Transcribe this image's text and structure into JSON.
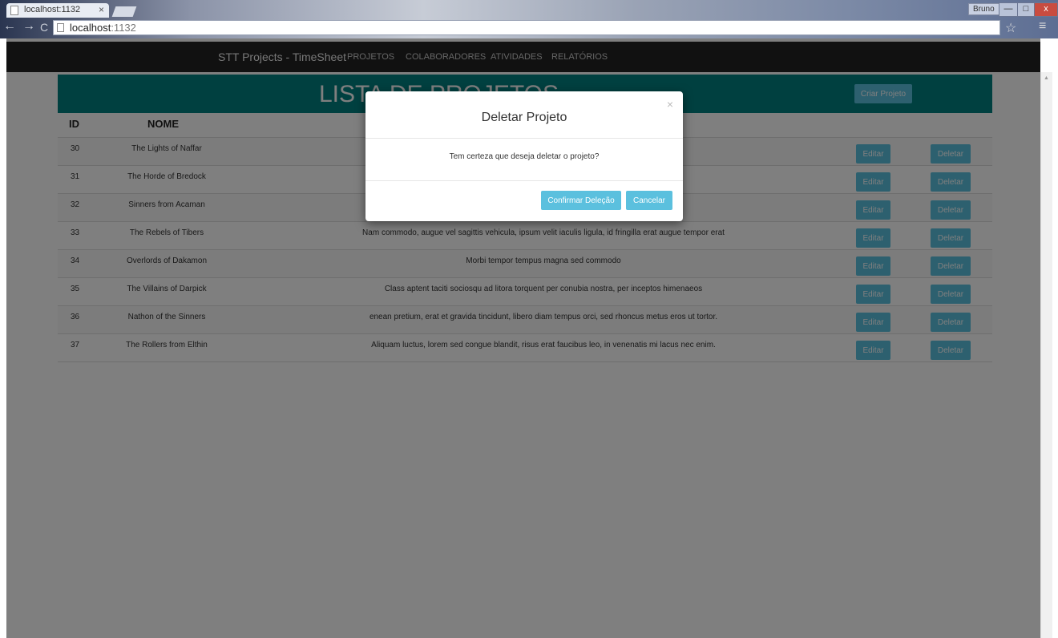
{
  "browser": {
    "tab_title": "localhost:1132",
    "tab_close": "×",
    "address_host": "localhost",
    "address_port": ":1132",
    "user_badge": "Bruno",
    "win_min": "—",
    "win_max": "□",
    "win_close": "x",
    "back": "←",
    "forward": "→",
    "reload": "C",
    "star": "☆",
    "menu": "≡"
  },
  "navbar": {
    "brand": "STT Projects - TimeSheet",
    "links": [
      "PROJETOS",
      "COLABORADORES",
      "ATIVIDADES",
      "RELATÓRIOS"
    ]
  },
  "header": {
    "title": "LISTA DE PROJETOS",
    "create_button": "Criar Projeto"
  },
  "table": {
    "columns": [
      "ID",
      "NOME"
    ],
    "rows": [
      {
        "id": "30",
        "nome": "The Lights of Naffar",
        "descricao": ""
      },
      {
        "id": "31",
        "nome": "The Horde of Bredock",
        "descricao": ""
      },
      {
        "id": "32",
        "nome": "Sinners from Acaman",
        "descricao": ""
      },
      {
        "id": "33",
        "nome": "The Rebels of Tibers",
        "descricao": "Nam commodo, augue vel sagittis vehicula, ipsum velit iaculis ligula, id fringilla erat augue tempor erat"
      },
      {
        "id": "34",
        "nome": "Overlords of Dakamon",
        "descricao": "Morbi tempor tempus magna sed commodo"
      },
      {
        "id": "35",
        "nome": "The Villains of Darpick",
        "descricao": "Class aptent taciti sociosqu ad litora torquent per conubia nostra, per inceptos himenaeos"
      },
      {
        "id": "36",
        "nome": "Nathon of the Sinners",
        "descricao": "enean pretium, erat et gravida tincidunt, libero diam tempus orci, sed rhoncus metus eros ut tortor."
      },
      {
        "id": "37",
        "nome": "The Rollers from Elthin",
        "descricao": "Aliquam luctus, lorem sed congue blandit, risus erat faucibus leo, in venenatis mi lacus nec enim."
      }
    ],
    "edit_label": "Editar",
    "delete_label": "Deletar"
  },
  "modal": {
    "title": "Deletar Projeto",
    "close": "×",
    "message": "Tem certeza que deseja deletar o projeto?",
    "confirm_button": "Confirmar Deleção",
    "cancel_button": "Cancelar"
  },
  "colors": {
    "accent": "#5bc0de",
    "header_bg": "#008080",
    "navbar_bg": "#222222"
  }
}
